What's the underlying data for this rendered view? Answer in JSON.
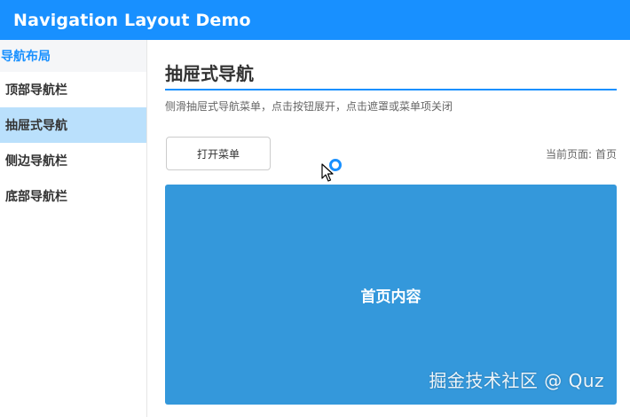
{
  "app": {
    "title": "Navigation Layout Demo",
    "header_color": "#1890ff"
  },
  "sidebar": {
    "heading": "导航布局",
    "items": [
      {
        "label": "顶部导航栏",
        "active": false
      },
      {
        "label": "抽屉式导航",
        "active": true
      },
      {
        "label": "侧边导航栏",
        "active": false
      },
      {
        "label": "底部导航栏",
        "active": false
      }
    ],
    "active_color": "#bae0fc"
  },
  "main": {
    "title": "抽屉式导航",
    "description": "侧滑抽屉式导航菜单，点击按钮展开，点击遮罩或菜单项关闭",
    "open_menu_label": "打开菜单",
    "current_page_label": "当前页面:",
    "current_page_value": "首页",
    "content_label": "首页内容",
    "content_color": "#3498db"
  },
  "watermark": "掘金技术社区 @ Quz",
  "icons": {
    "cursor": "arrow-pointer-icon",
    "click": "click-ring-icon"
  }
}
